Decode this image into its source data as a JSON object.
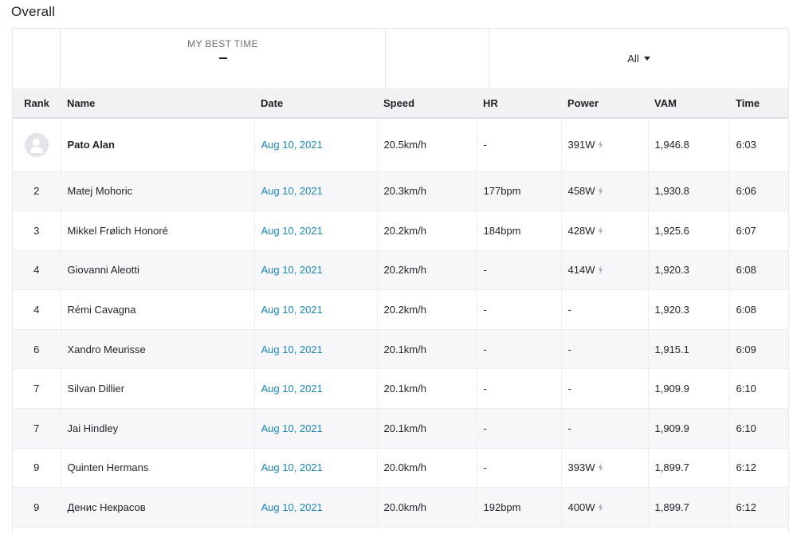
{
  "section": {
    "title": "Overall"
  },
  "summary": {
    "best_time_label": "MY BEST TIME",
    "best_time_value": "",
    "filter_label": "All"
  },
  "table": {
    "columns": [
      "Rank",
      "Name",
      "Date",
      "Speed",
      "HR",
      "Power",
      "VAM",
      "Time"
    ],
    "rows": [
      {
        "rank": "",
        "avatar": "avatar-icon",
        "name": "Pato Alan",
        "date": "Aug 10, 2021",
        "speed": "20.5km/h",
        "hr": "-",
        "power": "391W",
        "power_estimated": true,
        "vam": "1,946.8",
        "time": "6:03"
      },
      {
        "rank": "2",
        "name": "Matej Mohoric",
        "date": "Aug 10, 2021",
        "speed": "20.3km/h",
        "hr": "177bpm",
        "power": "458W",
        "power_estimated": true,
        "vam": "1,930.8",
        "time": "6:06"
      },
      {
        "rank": "3",
        "name": "Mikkel Frølich Honoré",
        "date": "Aug 10, 2021",
        "speed": "20.2km/h",
        "hr": "184bpm",
        "power": "428W",
        "power_estimated": true,
        "vam": "1,925.6",
        "time": "6:07"
      },
      {
        "rank": "4",
        "name": "Giovanni Aleotti",
        "date": "Aug 10, 2021",
        "speed": "20.2km/h",
        "hr": "-",
        "power": "414W",
        "power_estimated": true,
        "vam": "1,920.3",
        "time": "6:08"
      },
      {
        "rank": "4",
        "name": "Rémi Cavagna",
        "date": "Aug 10, 2021",
        "speed": "20.2km/h",
        "hr": "-",
        "power": "-",
        "power_estimated": false,
        "vam": "1,920.3",
        "time": "6:08"
      },
      {
        "rank": "6",
        "name": "Xandro Meurisse",
        "date": "Aug 10, 2021",
        "speed": "20.1km/h",
        "hr": "-",
        "power": "-",
        "power_estimated": false,
        "vam": "1,915.1",
        "time": "6:09"
      },
      {
        "rank": "7",
        "name": "Silvan Dillier",
        "date": "Aug 10, 2021",
        "speed": "20.1km/h",
        "hr": "-",
        "power": "-",
        "power_estimated": false,
        "vam": "1,909.9",
        "time": "6:10"
      },
      {
        "rank": "7",
        "name": "Jai Hindley",
        "date": "Aug 10, 2021",
        "speed": "20.1km/h",
        "hr": "-",
        "power": "-",
        "power_estimated": false,
        "vam": "1,909.9",
        "time": "6:10"
      },
      {
        "rank": "9",
        "name": "Quinten Hermans",
        "date": "Aug 10, 2021",
        "speed": "20.0km/h",
        "hr": "-",
        "power": "393W",
        "power_estimated": true,
        "vam": "1,899.7",
        "time": "6:12"
      },
      {
        "rank": "9",
        "name": "Денис Некрасов",
        "date": "Aug 10, 2021",
        "speed": "20.0km/h",
        "hr": "192bpm",
        "power": "400W",
        "power_estimated": true,
        "vam": "1,899.7",
        "time": "6:12"
      }
    ]
  },
  "colors": {
    "link": "#1a86b8",
    "header_bg": "#f2f2f5",
    "text": "#242428"
  },
  "icons": {
    "power_estimated": "lightning-bolt-icon",
    "filter_dropdown": "caret-down-icon",
    "user": "avatar-icon"
  }
}
